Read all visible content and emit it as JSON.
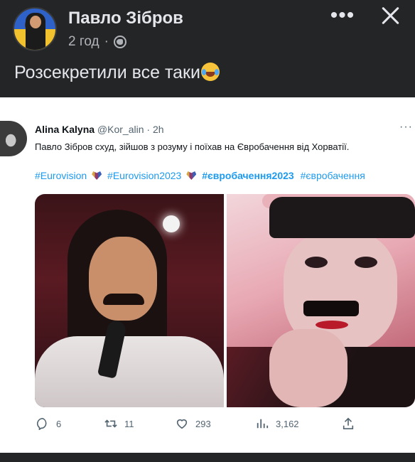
{
  "post": {
    "author": "Павло Зібров",
    "time": "2 год",
    "separator": "·",
    "text": "Розсекретили все таки"
  },
  "tweet": {
    "name": "Alina Kalyna",
    "handle": "@Kor_alin",
    "time": "· 2h",
    "more": "···",
    "text": "Павло Зібров схуд, зійшов з розуму і поїхав на Євробачення від Хорватії.",
    "hashtags": [
      "#Eurovision",
      "#Eurovision2023",
      "#євробачення2023",
      "#євробачення"
    ],
    "stats": {
      "replies": "6",
      "retweets": "11",
      "likes": "293",
      "views": "3,162"
    }
  },
  "colors": {
    "background": "#242526",
    "text_primary": "#e4e6eb",
    "text_secondary": "#b0b3b8",
    "tweet_link": "#1d9bf0"
  }
}
